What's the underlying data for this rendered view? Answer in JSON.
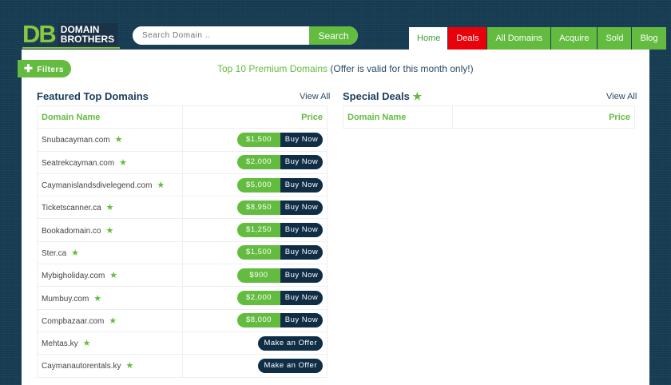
{
  "logo": {
    "letters": "DB",
    "line1": "DOMAIN",
    "line2": "BROTHERS"
  },
  "search": {
    "placeholder": "Search Domain ..",
    "button": "Search"
  },
  "nav": [
    "Home",
    "Deals",
    "All Domains",
    "Acquire",
    "Sold",
    "Blog"
  ],
  "filters": "Filters",
  "promo": {
    "highlight": "Top 10 Premium Domains",
    "rest": " (Offer is valid for this month only!)"
  },
  "featured": {
    "title": "Featured Top Domains",
    "view_all": "View All",
    "col_name": "Domain Name",
    "col_price": "Price",
    "rows": [
      {
        "name": "Snubacayman.com",
        "price": "$1,500",
        "action": "Buy Now"
      },
      {
        "name": "Seatrekcayman.com",
        "price": "$2,000",
        "action": "Buy Now"
      },
      {
        "name": "Caymanislandsdivelegend.com",
        "price": "$5,000",
        "action": "Buy Now"
      },
      {
        "name": "Ticketscanner.ca",
        "price": "$8,950",
        "action": "Buy Now"
      },
      {
        "name": "Bookadomain.co",
        "price": "$1,250",
        "action": "Buy Now"
      },
      {
        "name": "Ster.ca",
        "price": "$1,500",
        "action": "Buy Now"
      },
      {
        "name": "Mybigholiday.com",
        "price": "$900",
        "action": "Buy Now"
      },
      {
        "name": "Mumbuy.com",
        "price": "$2,000",
        "action": "Buy Now"
      },
      {
        "name": "Compbazaar.com",
        "price": "$8,000",
        "action": "Buy Now"
      },
      {
        "name": "Mehtas.ky",
        "price": null,
        "action": "Make an Offer"
      },
      {
        "name": "Caymanautorentals.ky",
        "price": null,
        "action": "Make an Offer"
      }
    ]
  },
  "special": {
    "title": "Special Deals",
    "view_all": "View All",
    "col_name": "Domain Name",
    "col_price": "Price"
  }
}
